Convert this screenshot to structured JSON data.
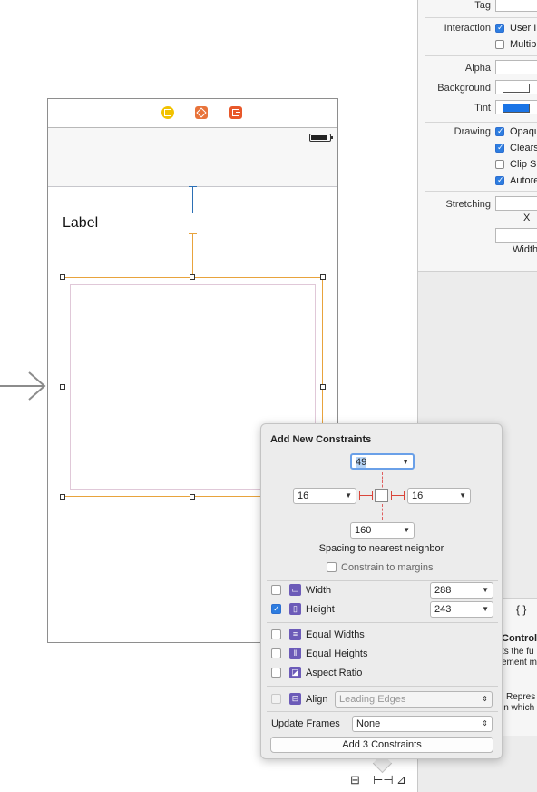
{
  "canvas": {
    "label_text": "Label",
    "dock_icons": [
      {
        "name": "view-controller-icon",
        "color": "#f2c200"
      },
      {
        "name": "first-responder-icon",
        "color": "#e8733a"
      },
      {
        "name": "exit-icon",
        "color": "#e8582a"
      }
    ],
    "constraint_color": "#e8a33d",
    "entry_arrow_icon": "storyboard-entry-arrow-icon"
  },
  "inspector": {
    "tag_label": "Tag",
    "interaction_label": "Interaction",
    "interaction_options": [
      "User I",
      "Multip"
    ],
    "alpha_label": "Alpha",
    "background_label": "Background",
    "tint_label": "Tint",
    "tint_color": "#1a74e6",
    "drawing_label": "Drawing",
    "drawing_options": [
      "Opaqu",
      "Clears",
      "Clip S",
      "Autore"
    ],
    "stretching_label": "Stretching",
    "x_label": "X",
    "width_label": "Width",
    "braces_icon": "{ }",
    "library_title": "Control",
    "library_desc_1": "ts the fu",
    "library_desc_2": "ement m",
    "library2_desc_1": "Repres",
    "library2_desc_2": "in which"
  },
  "popover": {
    "title": "Add New Constraints",
    "top_value": "49",
    "left_value": "16",
    "right_value": "16",
    "bottom_value": "160",
    "spacing_label": "Spacing to nearest neighbor",
    "constrain_margins_label": "Constrain to margins",
    "width_label": "Width",
    "width_value": "288",
    "height_label": "Height",
    "height_value": "243",
    "equal_widths_label": "Equal Widths",
    "equal_heights_label": "Equal Heights",
    "aspect_ratio_label": "Aspect Ratio",
    "align_label": "Align",
    "align_value": "Leading Edges",
    "update_frames_label": "Update Frames",
    "update_frames_value": "None",
    "add_button_label": "Add 3 Constraints"
  },
  "bottom_bar": {
    "icons": [
      "stack-icon",
      "pin-icon",
      "resolve-icon"
    ]
  }
}
